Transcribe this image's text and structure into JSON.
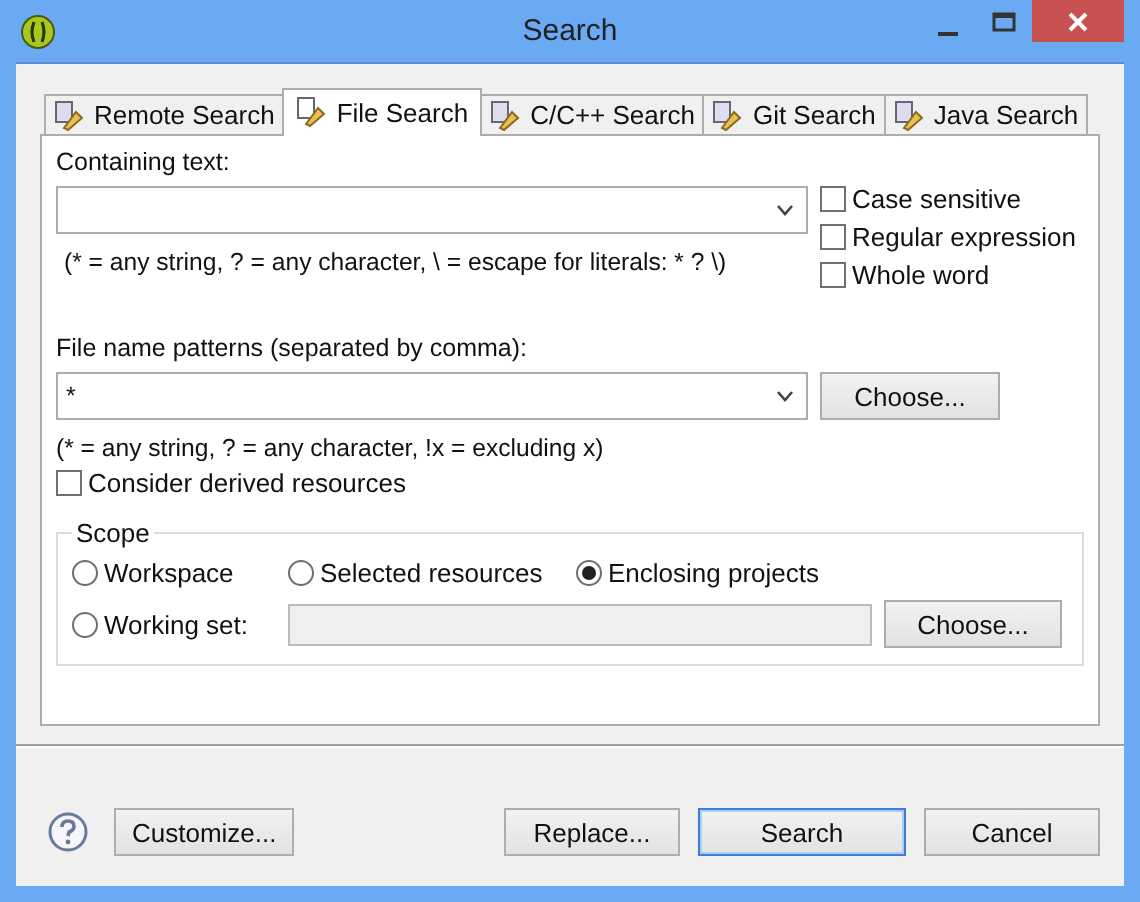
{
  "window": {
    "title": "Search"
  },
  "tabs": [
    {
      "label": "Remote Search",
      "selected": false
    },
    {
      "label": "File Search",
      "selected": true
    },
    {
      "label": "C/C++ Search",
      "selected": false
    },
    {
      "label": "Git Search",
      "selected": false
    },
    {
      "label": "Java Search",
      "selected": false
    }
  ],
  "containing_text": {
    "label": "Containing text:",
    "hint": "(* = any string, ? = any character, \\ = escape for literals: * ? \\)"
  },
  "options": [
    {
      "label": "Case sensitive",
      "checked": false
    },
    {
      "label": "Regular expression",
      "checked": false
    },
    {
      "label": "Whole word",
      "checked": false
    }
  ],
  "file_name_patterns": {
    "label": "File name patterns (separated by comma):",
    "value": "*",
    "choose": "Choose...",
    "hint": "(* = any string, ? = any character, !x = excluding x)"
  },
  "derived": {
    "label": "Consider derived resources",
    "checked": false
  },
  "scope": {
    "title": "Scope",
    "options": [
      {
        "label": "Workspace",
        "selected": false
      },
      {
        "label": "Selected resources",
        "selected": false
      },
      {
        "label": "Enclosing projects",
        "selected": true
      },
      {
        "label": "Working set:",
        "selected": false
      }
    ],
    "choose": "Choose..."
  },
  "buttons": [
    {
      "label": "Customize...",
      "default": false
    },
    {
      "label": "Replace...",
      "default": false
    },
    {
      "label": "Search",
      "default": true
    },
    {
      "label": "Cancel",
      "default": false
    }
  ]
}
